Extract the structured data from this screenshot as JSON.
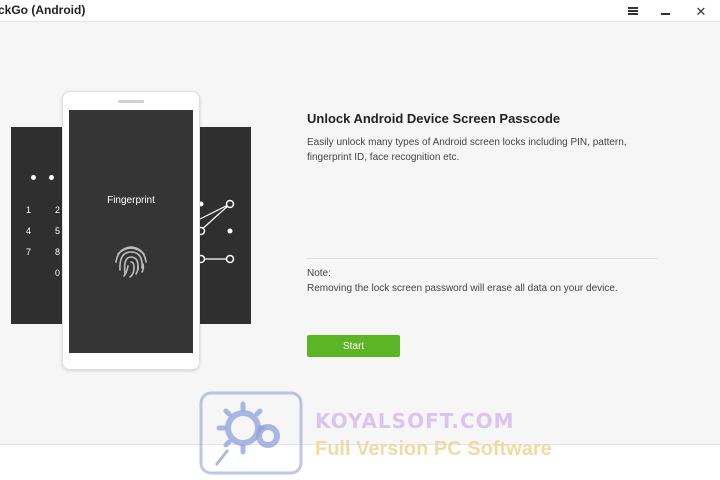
{
  "window": {
    "title": "ckGo (Android)",
    "controls": {
      "menu_icon": "hamburger-icon",
      "minimize_icon": "minimize-icon",
      "close_icon": "close-icon"
    }
  },
  "illustration": {
    "phone_label": "Fingerprint",
    "keypad_digits": [
      "1",
      "2",
      "4",
      "5",
      "7",
      "8",
      "0"
    ],
    "fingerprint_icon": "fingerprint-icon"
  },
  "info": {
    "title": "Unlock Android Device Screen Passcode",
    "description": "Easily unlock many types of Android screen locks including PIN, pattern, fingerprint ID, face recognition etc.",
    "note_label": "Note:",
    "note_text": "Removing the lock screen password will erase all data on your device.",
    "start_label": "Start"
  },
  "colors": {
    "accent": "#5cb524",
    "panel_dark": "#353535",
    "background": "#f6f6f6"
  },
  "watermark": {
    "brand": "KOYALSOFT.COM",
    "tagline": "Full Version PC Software"
  }
}
